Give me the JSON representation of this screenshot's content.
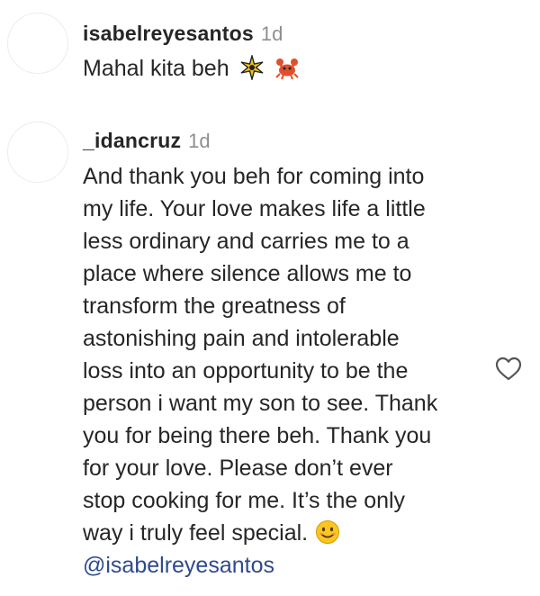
{
  "comments": [
    {
      "username": "isabelreyesantos",
      "time": "1d",
      "text": "Mahal kita beh",
      "emojis": [
        "sparkle-emoji",
        "crab-emoji"
      ]
    },
    {
      "username": "_idancruz",
      "time": "1d",
      "lines": [
        "And thank you beh for coming into",
        "my life. Your love makes life a little",
        "less ordinary and carries me to a",
        "place where silence allows me to",
        "transform the greatness of",
        "astonishing pain and intolerable",
        "loss into an opportunity to be the",
        "person i want my son to see. Thank",
        "you for being there beh. Thank you",
        "for your love. Please don’t ever",
        "stop cooking for me. It’s the only",
        "way i truly feel special."
      ],
      "end_emoji": "smiling-face-emoji",
      "mention": "@isabelreyesantos",
      "like_icon": "heart-outline-icon"
    }
  ]
}
